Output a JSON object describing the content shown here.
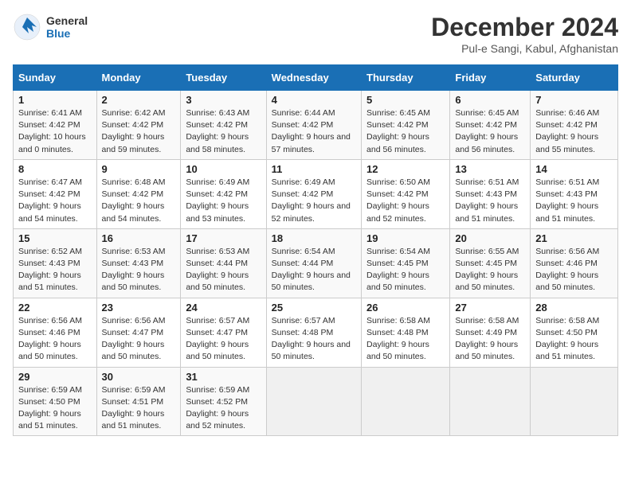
{
  "logo": {
    "line1": "General",
    "line2": "Blue"
  },
  "title": "December 2024",
  "subtitle": "Pul-e Sangi, Kabul, Afghanistan",
  "columns": [
    "Sunday",
    "Monday",
    "Tuesday",
    "Wednesday",
    "Thursday",
    "Friday",
    "Saturday"
  ],
  "weeks": [
    [
      {
        "day": "1",
        "sunrise": "6:41 AM",
        "sunset": "4:42 PM",
        "daylight": "10 hours and 0 minutes."
      },
      {
        "day": "2",
        "sunrise": "6:42 AM",
        "sunset": "4:42 PM",
        "daylight": "9 hours and 59 minutes."
      },
      {
        "day": "3",
        "sunrise": "6:43 AM",
        "sunset": "4:42 PM",
        "daylight": "9 hours and 58 minutes."
      },
      {
        "day": "4",
        "sunrise": "6:44 AM",
        "sunset": "4:42 PM",
        "daylight": "9 hours and 57 minutes."
      },
      {
        "day": "5",
        "sunrise": "6:45 AM",
        "sunset": "4:42 PM",
        "daylight": "9 hours and 56 minutes."
      },
      {
        "day": "6",
        "sunrise": "6:45 AM",
        "sunset": "4:42 PM",
        "daylight": "9 hours and 56 minutes."
      },
      {
        "day": "7",
        "sunrise": "6:46 AM",
        "sunset": "4:42 PM",
        "daylight": "9 hours and 55 minutes."
      }
    ],
    [
      {
        "day": "8",
        "sunrise": "6:47 AM",
        "sunset": "4:42 PM",
        "daylight": "9 hours and 54 minutes."
      },
      {
        "day": "9",
        "sunrise": "6:48 AM",
        "sunset": "4:42 PM",
        "daylight": "9 hours and 54 minutes."
      },
      {
        "day": "10",
        "sunrise": "6:49 AM",
        "sunset": "4:42 PM",
        "daylight": "9 hours and 53 minutes."
      },
      {
        "day": "11",
        "sunrise": "6:49 AM",
        "sunset": "4:42 PM",
        "daylight": "9 hours and 52 minutes."
      },
      {
        "day": "12",
        "sunrise": "6:50 AM",
        "sunset": "4:42 PM",
        "daylight": "9 hours and 52 minutes."
      },
      {
        "day": "13",
        "sunrise": "6:51 AM",
        "sunset": "4:43 PM",
        "daylight": "9 hours and 51 minutes."
      },
      {
        "day": "14",
        "sunrise": "6:51 AM",
        "sunset": "4:43 PM",
        "daylight": "9 hours and 51 minutes."
      }
    ],
    [
      {
        "day": "15",
        "sunrise": "6:52 AM",
        "sunset": "4:43 PM",
        "daylight": "9 hours and 51 minutes."
      },
      {
        "day": "16",
        "sunrise": "6:53 AM",
        "sunset": "4:43 PM",
        "daylight": "9 hours and 50 minutes."
      },
      {
        "day": "17",
        "sunrise": "6:53 AM",
        "sunset": "4:44 PM",
        "daylight": "9 hours and 50 minutes."
      },
      {
        "day": "18",
        "sunrise": "6:54 AM",
        "sunset": "4:44 PM",
        "daylight": "9 hours and 50 minutes."
      },
      {
        "day": "19",
        "sunrise": "6:54 AM",
        "sunset": "4:45 PM",
        "daylight": "9 hours and 50 minutes."
      },
      {
        "day": "20",
        "sunrise": "6:55 AM",
        "sunset": "4:45 PM",
        "daylight": "9 hours and 50 minutes."
      },
      {
        "day": "21",
        "sunrise": "6:56 AM",
        "sunset": "4:46 PM",
        "daylight": "9 hours and 50 minutes."
      }
    ],
    [
      {
        "day": "22",
        "sunrise": "6:56 AM",
        "sunset": "4:46 PM",
        "daylight": "9 hours and 50 minutes."
      },
      {
        "day": "23",
        "sunrise": "6:56 AM",
        "sunset": "4:47 PM",
        "daylight": "9 hours and 50 minutes."
      },
      {
        "day": "24",
        "sunrise": "6:57 AM",
        "sunset": "4:47 PM",
        "daylight": "9 hours and 50 minutes."
      },
      {
        "day": "25",
        "sunrise": "6:57 AM",
        "sunset": "4:48 PM",
        "daylight": "9 hours and 50 minutes."
      },
      {
        "day": "26",
        "sunrise": "6:58 AM",
        "sunset": "4:48 PM",
        "daylight": "9 hours and 50 minutes."
      },
      {
        "day": "27",
        "sunrise": "6:58 AM",
        "sunset": "4:49 PM",
        "daylight": "9 hours and 50 minutes."
      },
      {
        "day": "28",
        "sunrise": "6:58 AM",
        "sunset": "4:50 PM",
        "daylight": "9 hours and 51 minutes."
      }
    ],
    [
      {
        "day": "29",
        "sunrise": "6:59 AM",
        "sunset": "4:50 PM",
        "daylight": "9 hours and 51 minutes."
      },
      {
        "day": "30",
        "sunrise": "6:59 AM",
        "sunset": "4:51 PM",
        "daylight": "9 hours and 51 minutes."
      },
      {
        "day": "31",
        "sunrise": "6:59 AM",
        "sunset": "4:52 PM",
        "daylight": "9 hours and 52 minutes."
      },
      null,
      null,
      null,
      null
    ]
  ]
}
